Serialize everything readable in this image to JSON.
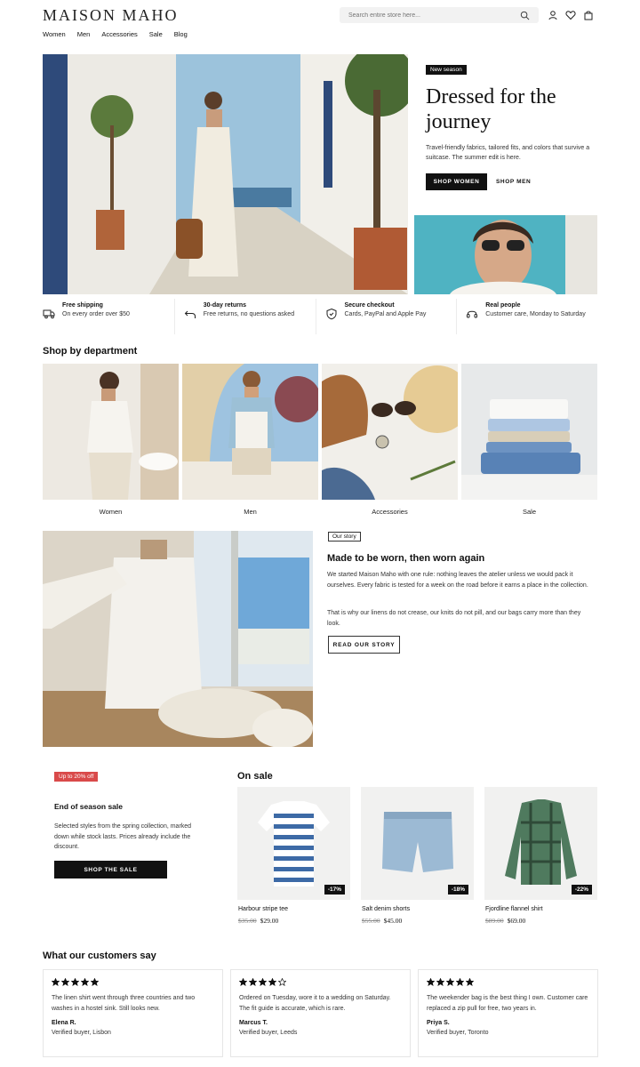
{
  "header": {
    "logo": "MAISON MAHO",
    "search_placeholder": "Search entire store here...",
    "nav": [
      "Women",
      "Men",
      "Accessories",
      "Sale",
      "Blog"
    ]
  },
  "hero": {
    "badge": "New season",
    "title": "Dressed for the journey",
    "text": "Travel-friendly fabrics, tailored fits, and colors that survive a suitcase. The summer edit is here.",
    "primary_button": "SHOP WOMEN",
    "secondary_button": "SHOP MEN"
  },
  "features": [
    {
      "title": "Free shipping",
      "subtitle": "On every order over $50",
      "icon": "truck-icon"
    },
    {
      "title": "30-day returns",
      "subtitle": "Free returns, no questions asked",
      "icon": "return-arrow-icon"
    },
    {
      "title": "Secure checkout",
      "subtitle": "Cards, PayPal and Apple Pay",
      "icon": "shield-icon"
    },
    {
      "title": "Real people",
      "subtitle": "Customer care, Monday to Saturday",
      "icon": "headset-icon"
    }
  ],
  "departments": {
    "title": "Shop by department",
    "items": [
      "Women",
      "Men",
      "Accessories",
      "Sale"
    ]
  },
  "story": {
    "badge": "Our story",
    "title": "Made to be worn, then worn again",
    "p1": "We started Maison Maho with one rule: nothing leaves the atelier unless we would pack it ourselves. Every fabric is tested for a week on the road before it earns a place in the collection.",
    "p2": "That is why our linens do not crease, our knits do not pill, and our bags carry more than they look.",
    "button": "READ OUR STORY"
  },
  "sale": {
    "badge": "Up to 20% off",
    "title": "End of season sale",
    "text": "Selected styles from the spring collection, marked down while stock lasts. Prices already include the discount.",
    "button": "SHOP THE SALE",
    "on_sale_title": "On sale",
    "products": [
      {
        "name": "Harbour stripe tee",
        "old_price": "$35.00",
        "price": "$29.00",
        "discount": "-17%"
      },
      {
        "name": "Salt denim shorts",
        "old_price": "$55.00",
        "price": "$45.00",
        "discount": "-18%"
      },
      {
        "name": "Fjordline flannel shirt",
        "old_price": "$89.00",
        "price": "$69.00",
        "discount": "-22%"
      }
    ]
  },
  "reviews": {
    "title": "What our customers say",
    "items": [
      {
        "rating": 5,
        "text": "The linen shirt went through three countries and two washes in a hostel sink. Still looks new.",
        "name": "Elena R.",
        "meta": "Verified buyer, Lisbon"
      },
      {
        "rating": 4,
        "text": "Ordered on Tuesday, wore it to a wedding on Saturday. The fit guide is accurate, which is rare.",
        "name": "Marcus T.",
        "meta": "Verified buyer, Leeds"
      },
      {
        "rating": 5,
        "text": "The weekender bag is the best thing I own. Customer care replaced a zip pull for free, two years in.",
        "name": "Priya S.",
        "meta": "Verified buyer, Toronto"
      }
    ]
  },
  "colors": {
    "accent_dark": "#111111",
    "sale_red": "#d94a4a",
    "border": "#e6e6e6"
  }
}
